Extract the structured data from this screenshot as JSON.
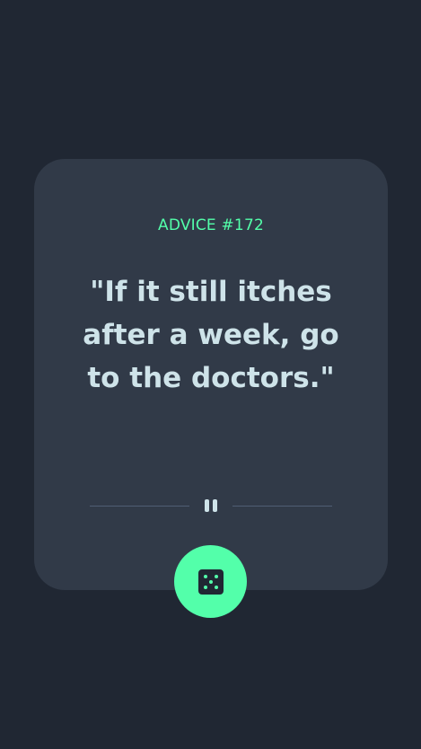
{
  "advice": {
    "id_label": "ADVICE #172",
    "quote": "\"If it still itches after a week, go to the doctors.\""
  },
  "icons": {
    "divider": "pause-icon",
    "generate": "dice-icon"
  },
  "colors": {
    "background": "#202733",
    "card": "#313a48",
    "accent": "#53ffaa",
    "quote_text": "#cee3e9",
    "divider_line": "#4f5d74"
  }
}
